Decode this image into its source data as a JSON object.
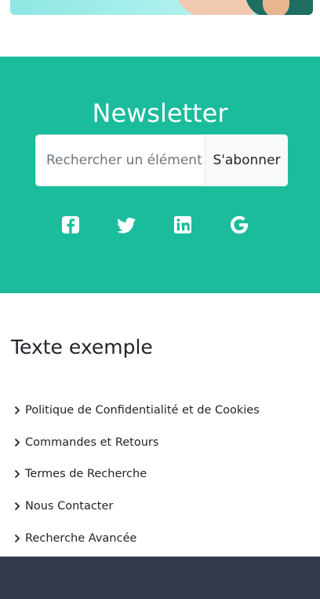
{
  "newsletter": {
    "title": "Newsletter",
    "input_placeholder": "Rechercher un élément",
    "subscribe_label": "S'abonner",
    "background_color": "#1abc9c"
  },
  "socials": [
    {
      "icon": "facebook-icon"
    },
    {
      "icon": "twitter-icon"
    },
    {
      "icon": "linkedin-icon"
    },
    {
      "icon": "google-icon"
    }
  ],
  "links_section": {
    "title": "Texte exemple",
    "items": [
      {
        "label": "Politique de Confidentialité et de Cookies"
      },
      {
        "label": "Commandes et Retours"
      },
      {
        "label": "Termes de Recherche"
      },
      {
        "label": "Nous Contacter"
      },
      {
        "label": "Recherche Avancée"
      }
    ]
  },
  "footer": {
    "background_color": "#343a4a"
  }
}
